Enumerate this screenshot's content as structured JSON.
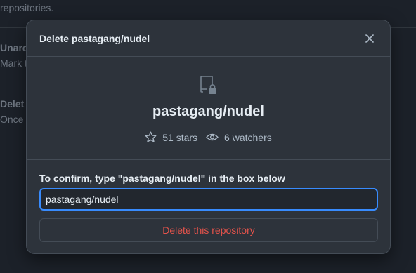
{
  "background": {
    "intro_text": "repositories.",
    "archive_title": "Unarc",
    "archive_desc": "Mark t",
    "delete_title": "Delet",
    "delete_desc": "Once"
  },
  "modal": {
    "title": "Delete pastagang/nudel",
    "close_icon": "close-icon",
    "repo_icon": "repo-locked-icon",
    "repo_name": "pastagang/nudel",
    "stars_icon": "star-icon",
    "stars_label": "51 stars",
    "watchers_icon": "eye-icon",
    "watchers_label": "6 watchers",
    "confirm_label": "To confirm, type \"pastagang/nudel\" in the box below",
    "confirm_value": "pastagang/nudel",
    "delete_button_label": "Delete this repository"
  },
  "colors": {
    "accent_focus": "#388bfd",
    "danger": "#e5534b"
  }
}
